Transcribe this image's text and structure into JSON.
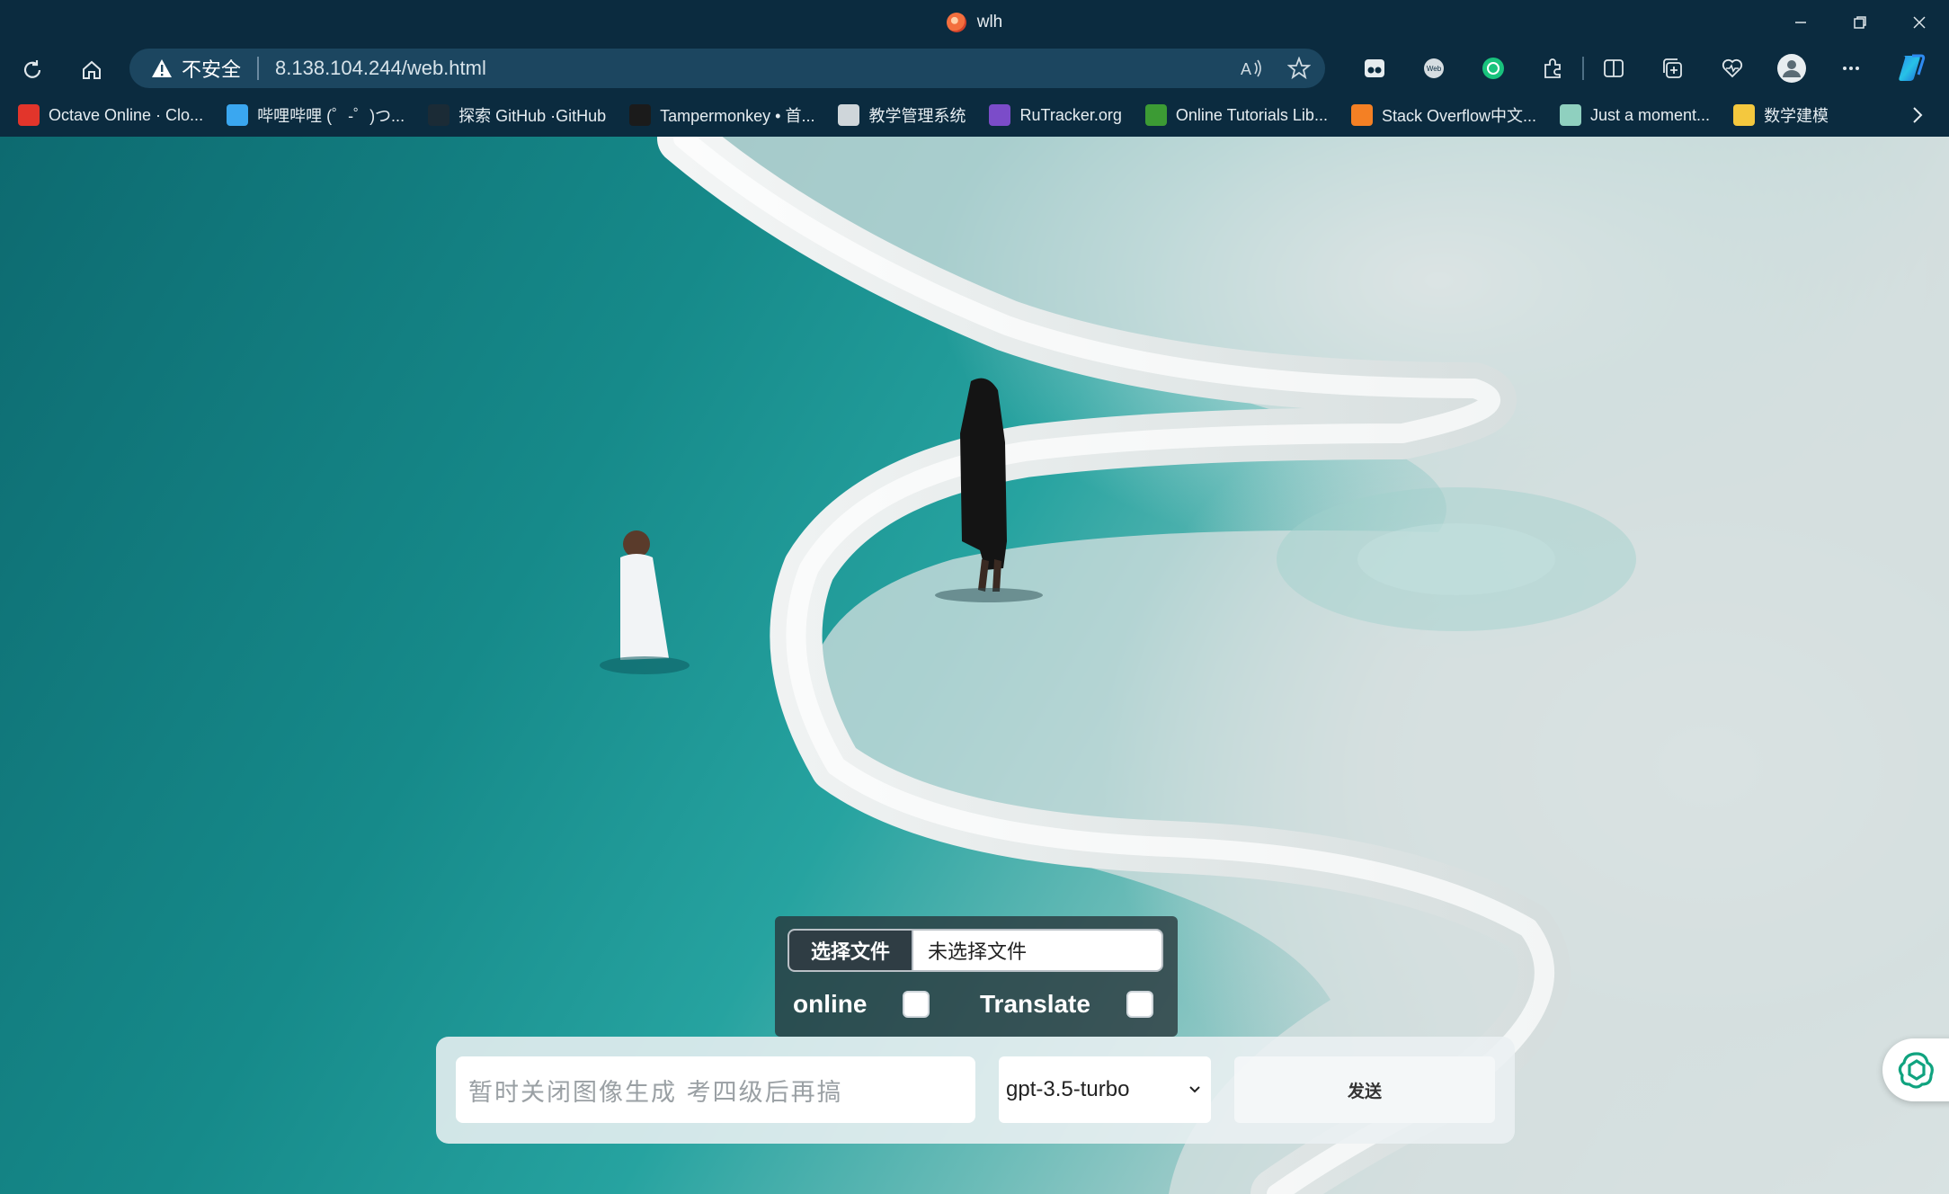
{
  "window": {
    "title": "wlh",
    "controls": {
      "minimize": "minimize",
      "restore": "restore",
      "close": "close"
    }
  },
  "address_bar": {
    "security_label": "不安全",
    "url": "8.138.104.244/web.html"
  },
  "bookmarks": [
    {
      "label": "Octave Online · Clo...",
      "icon": "octave-icon",
      "color": "#e2352b"
    },
    {
      "label": "哔哩哔哩 (゜-゜)つ...",
      "icon": "bilibili-icon",
      "color": "#3aa7f0"
    },
    {
      "label": "探索 GitHub ·GitHub",
      "icon": "github-icon",
      "color": "#1b2b36"
    },
    {
      "label": "Tampermonkey • 首...",
      "icon": "tampermonkey-icon",
      "color": "#1b1b1b"
    },
    {
      "label": "教学管理系统",
      "icon": "bank-icon",
      "color": "#cfd6da"
    },
    {
      "label": "RuTracker.org",
      "icon": "rutracker-icon",
      "color": "#7b4cc9"
    },
    {
      "label": "Online Tutorials Lib...",
      "icon": "tutorials-icon",
      "color": "#3c9b34"
    },
    {
      "label": "Stack Overflow中文...",
      "icon": "stackoverflow-icon",
      "color": "#f48024"
    },
    {
      "label": "Just a moment...",
      "icon": "openai-icon",
      "color": "#8fd0bf"
    },
    {
      "label": "数学建模",
      "icon": "folder-icon",
      "color": "#f4c83e"
    }
  ],
  "upload": {
    "choose_file_label": "选择文件",
    "file_status": "未选择文件",
    "online_label": "online",
    "translate_label": "Translate"
  },
  "chat": {
    "prompt_placeholder": "暂时关闭图像生成 考四级后再搞",
    "model_selected": "gpt-3.5-turbo",
    "send_label": "发送"
  },
  "colors": {
    "browser_chrome": "#0b2b3f",
    "omnibox": "#1c4660",
    "water": "#168a8a",
    "salt": "#e8eeee"
  }
}
